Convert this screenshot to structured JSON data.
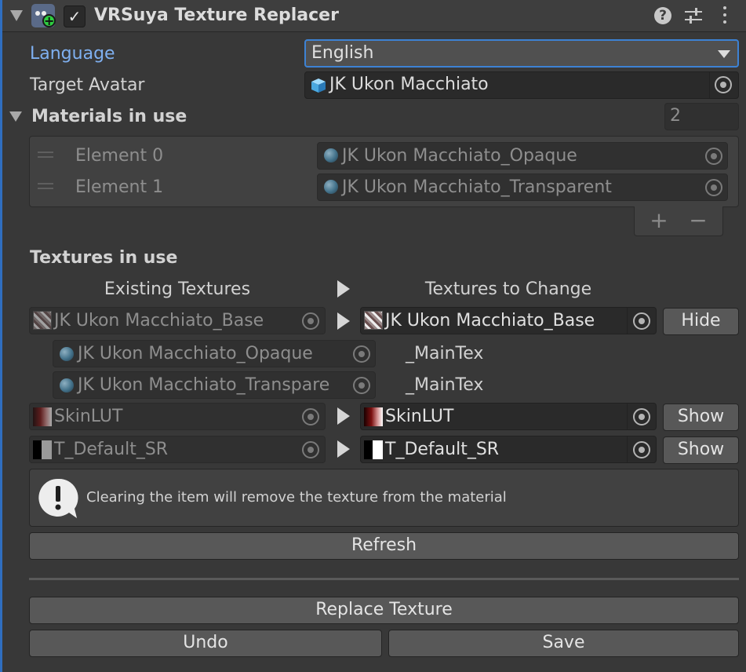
{
  "header": {
    "title": "VRSuya Texture Replacer"
  },
  "language": {
    "label": "Language",
    "value": "English"
  },
  "target_avatar": {
    "label": "Target Avatar",
    "value": "JK Ukon Macchiato"
  },
  "materials": {
    "label": "Materials in use",
    "count": "2",
    "elements": [
      {
        "label": "Element 0",
        "value": "JK Ukon Macchiato_Opaque"
      },
      {
        "label": "Element 1",
        "value": "JK Ukon Macchiato_Transparent"
      }
    ],
    "add_glyph": "+",
    "remove_glyph": "−"
  },
  "textures": {
    "label": "Textures in use",
    "col_existing": "Existing Textures",
    "col_change": "Textures to Change",
    "rows": [
      {
        "existing": "JK Ukon Macchiato_Base",
        "change": "JK Ukon Macchiato_Base",
        "toggle": "Hide"
      },
      {
        "existing": "SkinLUT",
        "change": "SkinLUT",
        "toggle": "Show"
      },
      {
        "existing": "T_Default_SR",
        "change": "T_Default_SR",
        "toggle": "Show"
      }
    ],
    "sub_rows": [
      {
        "material": "JK Ukon Macchiato_Opaque",
        "property": "_MainTex"
      },
      {
        "material": "JK Ukon Macchiato_Transpare",
        "property": "_MainTex"
      }
    ]
  },
  "help_box": {
    "text": "Clearing the item will remove the texture from the material"
  },
  "buttons": {
    "refresh": "Refresh",
    "replace": "Replace Texture",
    "undo": "Undo",
    "save": "Save"
  },
  "colors": {
    "accent_label": "#7fb0f0",
    "background": "#383838",
    "field": "#2a2a2a",
    "button": "#585858"
  }
}
